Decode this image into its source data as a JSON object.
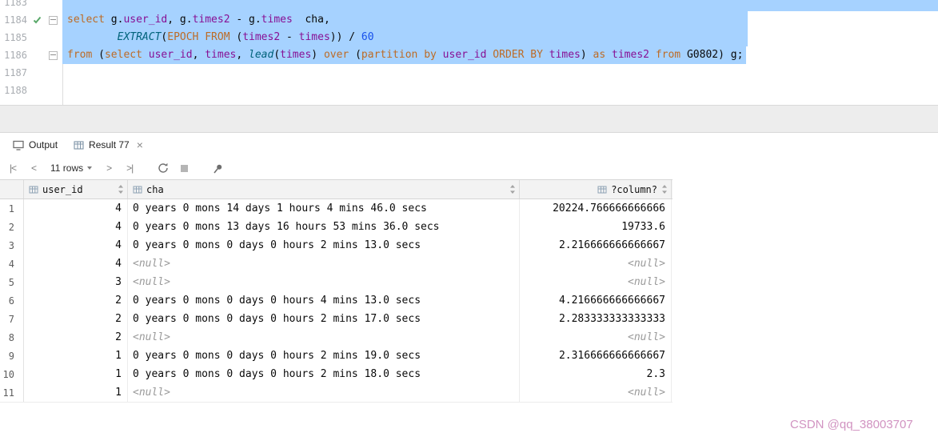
{
  "editor": {
    "lines": [
      {
        "number": "1183",
        "selection": "full",
        "tokens": []
      },
      {
        "number": "1184",
        "gutter_icon": "run-success-check",
        "fold": true,
        "selection": "mid",
        "tokens": [
          {
            "t": "kw",
            "s": "select"
          },
          {
            "t": "pl",
            "s": " g."
          },
          {
            "t": "fd",
            "s": "user_id"
          },
          {
            "t": "pl",
            "s": ", g."
          },
          {
            "t": "fd",
            "s": "times2"
          },
          {
            "t": "pl",
            "s": " - g."
          },
          {
            "t": "fd",
            "s": "times"
          },
          {
            "t": "pl",
            "s": "  cha,"
          }
        ]
      },
      {
        "number": "1185",
        "selection": "mid",
        "tokens": [
          {
            "t": "pl",
            "s": "        "
          },
          {
            "t": "fn",
            "s": "EXTRACT"
          },
          {
            "t": "pl",
            "s": "("
          },
          {
            "t": "kw",
            "s": "EPOCH FROM"
          },
          {
            "t": "pl",
            "s": " ("
          },
          {
            "t": "fd",
            "s": "times2"
          },
          {
            "t": "pl",
            "s": " - "
          },
          {
            "t": "fd",
            "s": "times"
          },
          {
            "t": "pl",
            "s": ")) / "
          },
          {
            "t": "num",
            "s": "60"
          }
        ]
      },
      {
        "number": "1186",
        "fold": true,
        "selection": "end",
        "tokens": [
          {
            "t": "kw",
            "s": "from"
          },
          {
            "t": "pl",
            "s": " ("
          },
          {
            "t": "kw",
            "s": "select"
          },
          {
            "t": "pl",
            "s": " "
          },
          {
            "t": "fd",
            "s": "user_id"
          },
          {
            "t": "pl",
            "s": ", "
          },
          {
            "t": "fd",
            "s": "times"
          },
          {
            "t": "pl",
            "s": ", "
          },
          {
            "t": "fn",
            "s": "lead"
          },
          {
            "t": "pl",
            "s": "("
          },
          {
            "t": "fd",
            "s": "times"
          },
          {
            "t": "pl",
            "s": ") "
          },
          {
            "t": "kw",
            "s": "over"
          },
          {
            "t": "pl",
            "s": " ("
          },
          {
            "t": "kw",
            "s": "partition by"
          },
          {
            "t": "pl",
            "s": " "
          },
          {
            "t": "fd",
            "s": "user_id"
          },
          {
            "t": "pl",
            "s": " "
          },
          {
            "t": "kw",
            "s": "ORDER BY"
          },
          {
            "t": "pl",
            "s": " "
          },
          {
            "t": "fd",
            "s": "times"
          },
          {
            "t": "pl",
            "s": ") "
          },
          {
            "t": "kw",
            "s": "as"
          },
          {
            "t": "pl",
            "s": " "
          },
          {
            "t": "fd",
            "s": "times2"
          },
          {
            "t": "pl",
            "s": " "
          },
          {
            "t": "kw",
            "s": "from"
          },
          {
            "t": "pl",
            "s": " "
          },
          {
            "t": "tbl",
            "s": "G0802"
          },
          {
            "t": "pl",
            "s": ") g;"
          }
        ]
      },
      {
        "number": "1187",
        "tokens": []
      },
      {
        "number": "1188",
        "tokens": []
      }
    ]
  },
  "panel": {
    "tabs": [
      {
        "label": "Output"
      },
      {
        "label": "Result 77",
        "close_glyph": "×"
      }
    ],
    "toolbar": {
      "first_label": "|<",
      "prev_label": "<",
      "rows_label": "11 rows",
      "next_label": ">",
      "last_label": ">|"
    }
  },
  "grid": {
    "columns": [
      {
        "name": "user_id"
      },
      {
        "name": "cha"
      },
      {
        "name": "?column?"
      }
    ],
    "null_text": "<null>",
    "rows": [
      {
        "n": "1",
        "user_id": "4",
        "cha": "0 years 0 mons 14 days 1 hours 4 mins 46.0 secs",
        "qcol": "20224.766666666666"
      },
      {
        "n": "2",
        "user_id": "4",
        "cha": "0 years 0 mons 13 days 16 hours 53 mins 36.0 secs",
        "qcol": "19733.6"
      },
      {
        "n": "3",
        "user_id": "4",
        "cha": "0 years 0 mons 0 days 0 hours 2 mins 13.0 secs",
        "qcol": "2.216666666666667"
      },
      {
        "n": "4",
        "user_id": "4",
        "cha": null,
        "qcol": null
      },
      {
        "n": "5",
        "user_id": "3",
        "cha": null,
        "qcol": null
      },
      {
        "n": "6",
        "user_id": "2",
        "cha": "0 years 0 mons 0 days 0 hours 4 mins 13.0 secs",
        "qcol": "4.216666666666667"
      },
      {
        "n": "7",
        "user_id": "2",
        "cha": "0 years 0 mons 0 days 0 hours 2 mins 17.0 secs",
        "qcol": "2.283333333333333"
      },
      {
        "n": "8",
        "user_id": "2",
        "cha": null,
        "qcol": null
      },
      {
        "n": "9",
        "user_id": "1",
        "cha": "0 years 0 mons 0 days 0 hours 2 mins 19.0 secs",
        "qcol": "2.316666666666667"
      },
      {
        "n": "10",
        "user_id": "1",
        "cha": "0 years 0 mons 0 days 0 hours 2 mins 18.0 secs",
        "qcol": "2.3"
      },
      {
        "n": "11",
        "user_id": "1",
        "cha": null,
        "qcol": null
      }
    ]
  },
  "watermark_text": "CSDN @qq_38003707"
}
